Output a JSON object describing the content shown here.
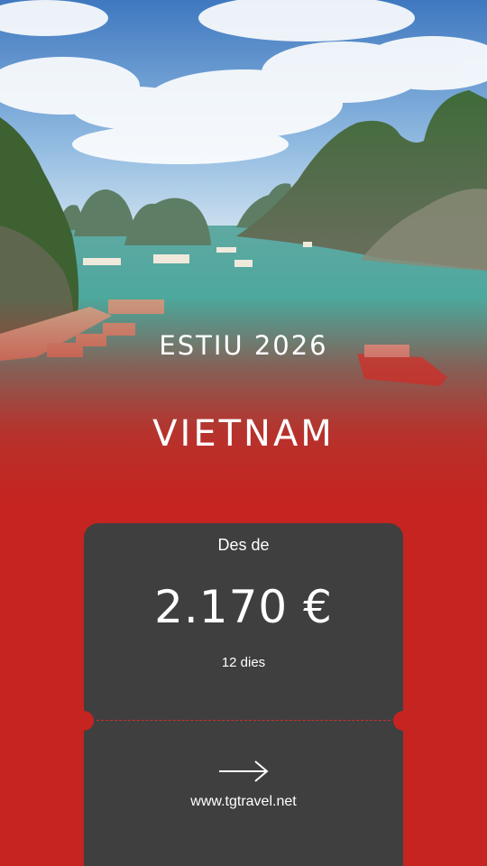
{
  "promo": {
    "season": "ESTIU 2026",
    "destination": "VIETNAM",
    "from_label": "Des de",
    "price": "2.170 €",
    "duration": "12 dies",
    "website": "www.tgtravel.net"
  },
  "colors": {
    "accent_red": "#c52420",
    "ticket_bg": "#3f3f3f",
    "text": "#ffffff"
  },
  "icons": {
    "cta": "arrow-right-icon"
  }
}
